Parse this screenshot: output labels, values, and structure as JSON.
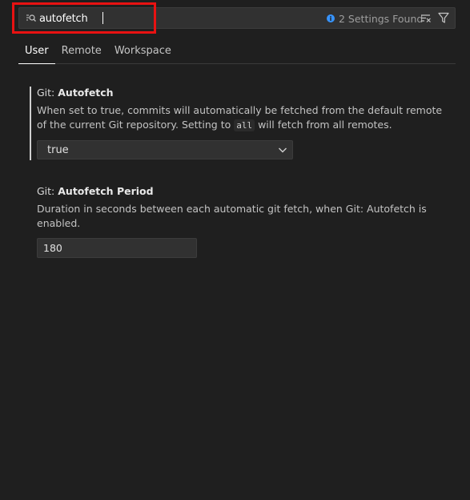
{
  "search": {
    "value": "autofetch",
    "results_label": "2 Settings Found"
  },
  "tabs": [
    {
      "label": "User"
    },
    {
      "label": "Remote"
    },
    {
      "label": "Workspace"
    }
  ],
  "settings": [
    {
      "category": "Git: ",
      "name": "Autofetch",
      "desc_before": "When set to true, commits will automatically be fetched from the default remote of the current Git repository. Setting to ",
      "desc_code": "all",
      "desc_after": " will fetch from all remotes.",
      "value": "true"
    },
    {
      "category": "Git: ",
      "name": "Autofetch Period",
      "description": "Duration in seconds between each automatic git fetch, when Git: Autofetch is enabled.",
      "value": "180"
    }
  ],
  "colors": {
    "highlight_box": "#e81212",
    "info": "#3794ff",
    "background": "#1f1f1f"
  }
}
